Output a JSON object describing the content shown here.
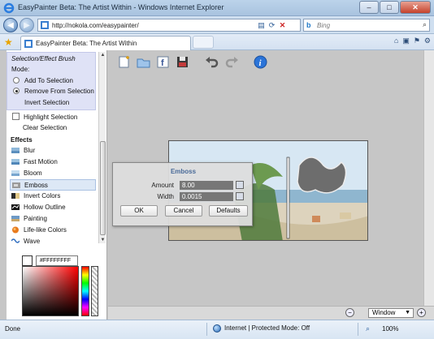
{
  "browser": {
    "window_title": "EasyPainter Beta: The Artist Within - Windows Internet Explorer",
    "url": "http://nokola.com/easypainter/",
    "search_placeholder": "Bing",
    "tab_label": "EasyPainter Beta: The Artist Within",
    "window_buttons": {
      "minimize": "–",
      "maximize": "□",
      "close": "✕"
    }
  },
  "sidebar": {
    "brush_title": "Selection/Effect Brush",
    "mode_label": "Mode:",
    "modes": [
      {
        "label": "Add To Selection",
        "selected": false
      },
      {
        "label": "Remove From Selection",
        "selected": true
      }
    ],
    "invert_selection": "Invert Selection",
    "highlight_selection": "Highlight Selection",
    "clear_selection": "Clear Selection",
    "effects_header": "Effects",
    "effects": [
      {
        "label": "Blur",
        "icon": "blur-icon"
      },
      {
        "label": "Fast Motion",
        "icon": "fast-motion-icon"
      },
      {
        "label": "Bloom",
        "icon": "bloom-icon"
      },
      {
        "label": "Emboss",
        "icon": "emboss-icon",
        "selected": true
      },
      {
        "label": "Invert Colors",
        "icon": "invert-colors-icon"
      },
      {
        "label": "Hollow Outline",
        "icon": "hollow-outline-icon"
      },
      {
        "label": "Painting",
        "icon": "painting-icon"
      },
      {
        "label": "Life-like Colors",
        "icon": "life-like-colors-icon"
      },
      {
        "label": "Wave",
        "icon": "wave-icon"
      }
    ],
    "color_hex": "#FFFFFFFF"
  },
  "toolbar": {
    "icons": [
      "new-image-icon",
      "open-folder-icon",
      "facebook-icon",
      "save-icon",
      "undo-icon",
      "redo-icon",
      "info-icon"
    ]
  },
  "dialog": {
    "title": "Emboss",
    "amount_label": "Amount",
    "amount_value": "8.00",
    "width_label": "Width",
    "width_value": "0.0015",
    "ok": "OK",
    "cancel": "Cancel",
    "defaults": "Defaults"
  },
  "bottom": {
    "zoom_mode": "Window"
  },
  "status": {
    "left": "Done",
    "zone": "Internet | Protected Mode: Off",
    "zoom": "100%"
  },
  "colors": {
    "app_background": "#c6c6c6",
    "brush_box": "#dfe2f6",
    "dialog_title": "#4a6b99",
    "ie_blue": "#2b6bb6"
  }
}
